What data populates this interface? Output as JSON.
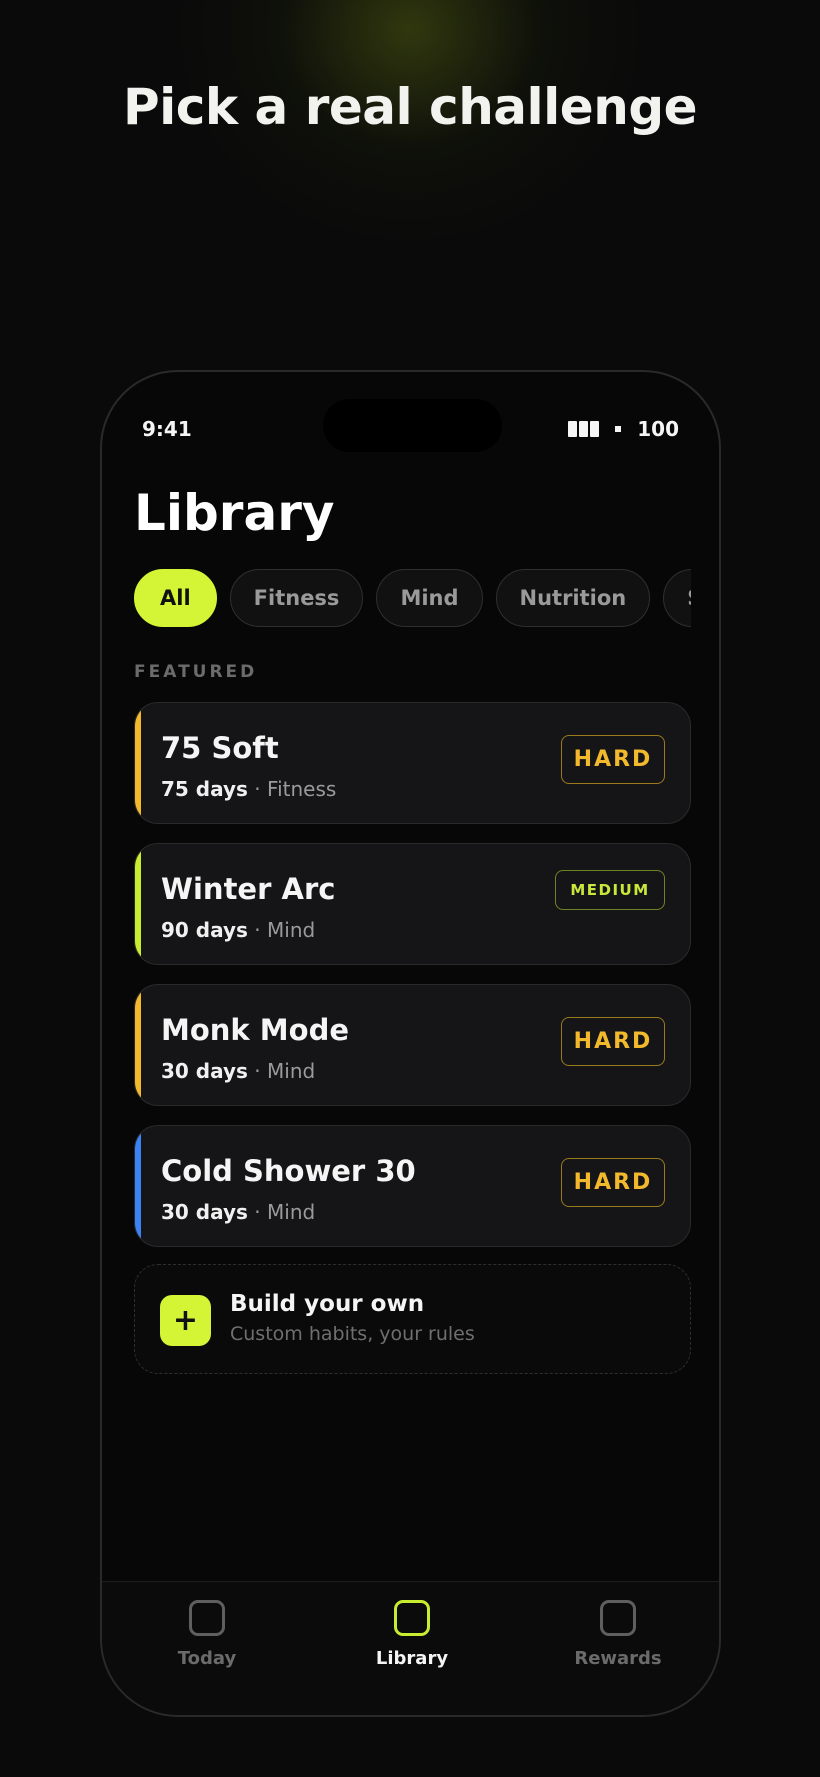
{
  "headline": "Pick a real challenge",
  "status_bar": {
    "time": "9:41",
    "battery": "100"
  },
  "page": {
    "title": "Library"
  },
  "filters": [
    "All",
    "Fitness",
    "Mind",
    "Nutrition",
    "Sleep"
  ],
  "active_filter": "All",
  "section_label": "FEATURED",
  "challenges": [
    {
      "name": "75 Soft",
      "days": "75 days",
      "category": "Fitness",
      "difficulty": "HARD",
      "accent": "#f3b92d"
    },
    {
      "name": "Winter Arc",
      "days": "90 days",
      "category": "Mind",
      "difficulty": "MEDIUM",
      "accent": "#c8ec2f"
    },
    {
      "name": "Monk Mode",
      "days": "30 days",
      "category": "Mind",
      "difficulty": "HARD",
      "accent": "#f3b92d"
    },
    {
      "name": "Cold Shower 30",
      "days": "30 days",
      "category": "Mind",
      "difficulty": "HARD",
      "accent": "#3b82f6"
    }
  ],
  "build_own": {
    "icon": "plus-icon",
    "plus_glyph": "+",
    "title": "Build your own",
    "subtitle": "Custom habits, your rules"
  },
  "tabs": [
    {
      "label": "Today",
      "icon": "today-icon"
    },
    {
      "label": "Library",
      "icon": "library-icon"
    },
    {
      "label": "Rewards",
      "icon": "rewards-icon"
    }
  ],
  "active_tab": "Library",
  "colors": {
    "accent": "#d4f535",
    "hard": "#f3b92d",
    "medium": "#c8e83a",
    "background": "#0a0a0a"
  }
}
